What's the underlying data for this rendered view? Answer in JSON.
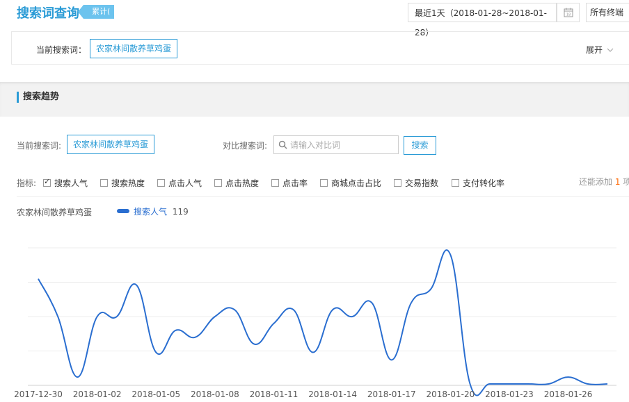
{
  "header": {
    "title": "搜索词查询",
    "badge": "累计(",
    "date_range": "最近1天（2018-01-28~2018-01-28）",
    "terminal": "所有终端"
  },
  "current_keyword": {
    "label": "当前搜索词：",
    "value": "农家林间散养草鸡蛋",
    "expand": "展开"
  },
  "trend": {
    "section_title": "搜索趋势",
    "current_label": "当前搜索词:",
    "current_value": "农家林间散养草鸡蛋",
    "compare_label": "对比搜索词:",
    "compare_placeholder": "请输入对比词",
    "search_button": "搜索",
    "indicators_label": "指标:",
    "indicators": [
      {
        "label": "搜索人气",
        "checked": true
      },
      {
        "label": "搜索热度",
        "checked": false
      },
      {
        "label": "点击人气",
        "checked": false
      },
      {
        "label": "点击热度",
        "checked": false
      },
      {
        "label": "点击率",
        "checked": false
      },
      {
        "label": "商城点击占比",
        "checked": false
      },
      {
        "label": "交易指数",
        "checked": false
      },
      {
        "label": "支付转化率",
        "checked": false
      }
    ],
    "add_more_prefix": "还能添加",
    "add_more_count": "1",
    "add_more_suffix": "项",
    "chart_keyword": "农家林间散养草鸡蛋",
    "legend_label": "搜索人气",
    "legend_value": "119"
  },
  "chart_data": {
    "type": "line",
    "x": [
      "2017-12-30",
      "2017-12-31",
      "2018-01-01",
      "2018-01-02",
      "2018-01-03",
      "2018-01-04",
      "2018-01-05",
      "2018-01-06",
      "2018-01-07",
      "2018-01-08",
      "2018-01-09",
      "2018-01-10",
      "2018-01-11",
      "2018-01-12",
      "2018-01-13",
      "2018-01-14",
      "2018-01-15",
      "2018-01-16",
      "2018-01-17",
      "2018-01-18",
      "2018-01-19",
      "2018-01-20",
      "2018-01-21",
      "2018-01-22",
      "2018-01-23",
      "2018-01-24",
      "2018-01-25",
      "2018-01-26",
      "2018-01-27",
      "2018-01-28"
    ],
    "x_ticks": [
      "2017-12-30",
      "2018-01-02",
      "2018-01-05",
      "2018-01-08",
      "2018-01-11",
      "2018-01-14",
      "2018-01-17",
      "2018-01-20",
      "2018-01-23",
      "2018-01-26"
    ],
    "series": [
      {
        "name": "搜索人气",
        "color": "#2a6ed0",
        "values": [
          155,
          100,
          12,
          100,
          100,
          146,
          48,
          80,
          70,
          100,
          110,
          60,
          90,
          110,
          48,
          110,
          100,
          120,
          37,
          120,
          140,
          190,
          2,
          2,
          2,
          2,
          2,
          12,
          2,
          2
        ]
      }
    ],
    "ylim": [
      0,
      200
    ],
    "grid": true
  }
}
